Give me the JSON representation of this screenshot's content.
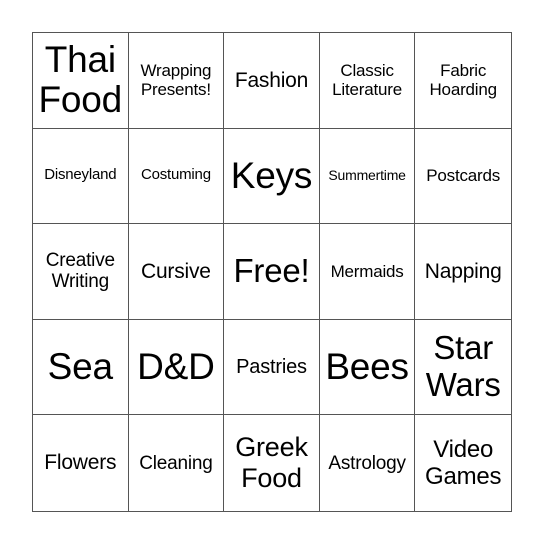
{
  "board": {
    "line_color": "#555555",
    "rows": [
      [
        {
          "text": "Thai\nFood",
          "size": "xl"
        },
        {
          "text": "Wrapping\nPresents!",
          "size": "xs"
        },
        {
          "text": "Fashion",
          "size": "md"
        },
        {
          "text": "Classic\nLiterature",
          "size": "xs"
        },
        {
          "text": "Fabric\nHoarding",
          "size": "xs"
        }
      ],
      [
        {
          "text": "Disneyland",
          "size": "xxs"
        },
        {
          "text": "Costuming",
          "size": "xxs"
        },
        {
          "text": "Keys",
          "size": "xl"
        },
        {
          "text": "Summertime",
          "size": "xxs"
        },
        {
          "text": "Postcards",
          "size": "xs"
        }
      ],
      [
        {
          "text": "Creative\nWriting",
          "size": "sm"
        },
        {
          "text": "Cursive",
          "size": "md"
        },
        {
          "text": "Free!",
          "size": "lg"
        },
        {
          "text": "Mermaids",
          "size": "xs"
        },
        {
          "text": "Napping",
          "size": "md"
        }
      ],
      [
        {
          "text": "Sea",
          "size": "xl"
        },
        {
          "text": "D&D",
          "size": "xl"
        },
        {
          "text": "Pastries",
          "size": "md"
        },
        {
          "text": "Bees",
          "size": "xl"
        },
        {
          "text": "Star\nWars",
          "size": "lg"
        }
      ],
      [
        {
          "text": "Flowers",
          "size": "md"
        },
        {
          "text": "Cleaning",
          "size": "sm"
        },
        {
          "text": "Greek\nFood",
          "size": "ml"
        },
        {
          "text": "Astrology",
          "size": "sm"
        },
        {
          "text": "Video\nGames",
          "size": "ml"
        }
      ]
    ]
  }
}
